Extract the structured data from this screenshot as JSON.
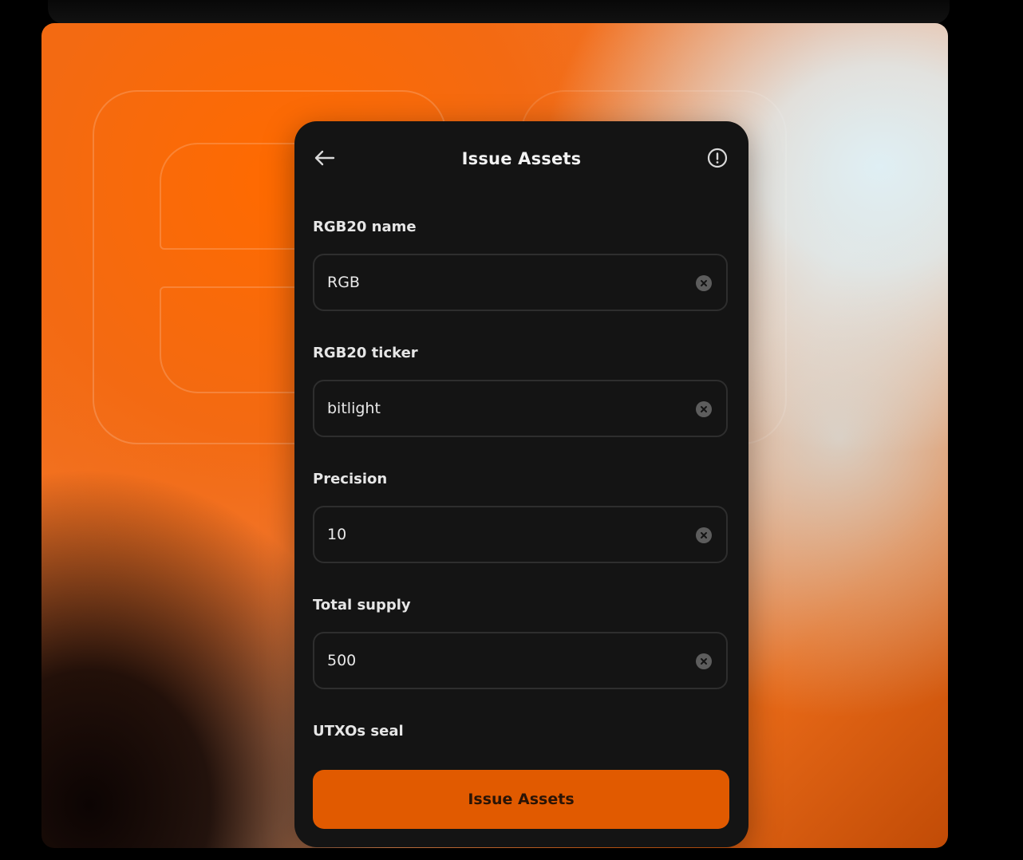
{
  "header": {
    "title": "Issue Assets",
    "back_icon": "arrow-left-icon",
    "info_icon": "info-circle-icon"
  },
  "form": {
    "fields": [
      {
        "label": "RGB20 name",
        "value": "RGB"
      },
      {
        "label": "RGB20 ticker",
        "value": "bitlight"
      },
      {
        "label": "Precision",
        "value": "10"
      },
      {
        "label": "Total supply",
        "value": "500"
      }
    ],
    "seal_label": "UTXOs seal",
    "clear_icon": "clear-circle-icon"
  },
  "submit": {
    "label": "Issue Assets"
  },
  "colors": {
    "accent": "#e15a00",
    "panel_bg": "#141414",
    "field_border": "#2e2e2e",
    "text": "#e8e8e8"
  }
}
